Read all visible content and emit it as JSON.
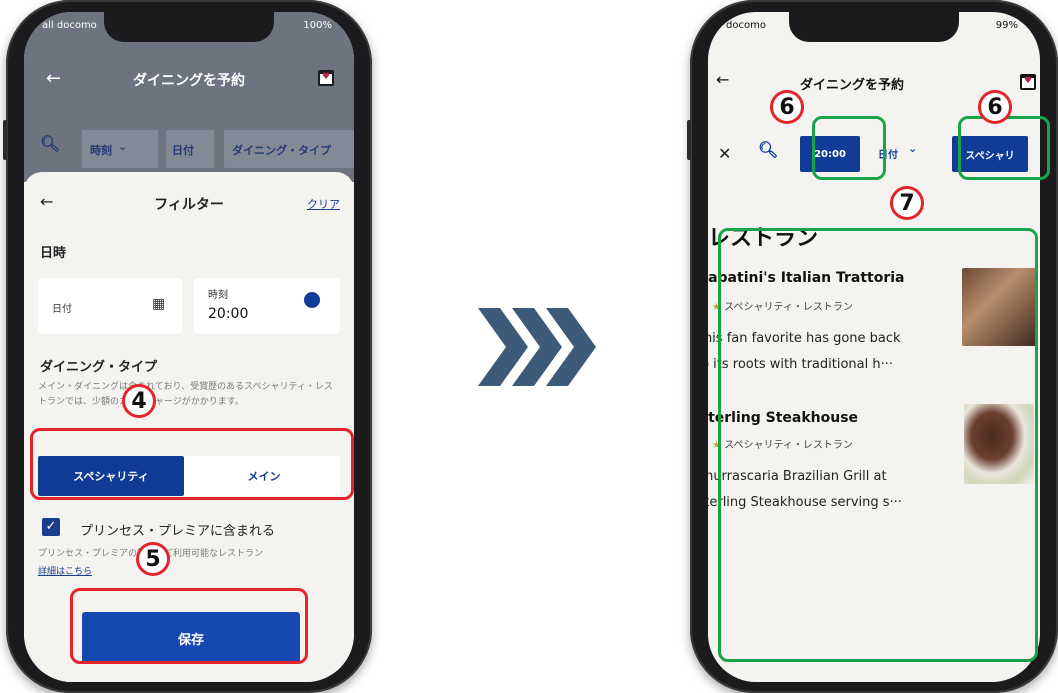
{
  "left_phone": {
    "status": {
      "carrier": "all docomo",
      "battery": "100%"
    },
    "appbar": {
      "title": "ダイニングを予約"
    },
    "chips": [
      {
        "label": "時刻"
      },
      {
        "label": "日付"
      },
      {
        "label": "ダイニング・タイプ"
      }
    ],
    "filter": {
      "title": "フィルター",
      "clear": "クリア",
      "datetime_heading": "日時",
      "date_label": "日付",
      "time_label": "時刻",
      "time_value": "20:00",
      "dining_type_heading": "ダイニング・タイプ",
      "dining_type_desc": "メイン・ダイニングは含まれており、受賞歴のあるスペシャリティ・レストランでは、少額のカバーチャージがかかります。",
      "options": [
        "スペシャリティ",
        "メイン"
      ],
      "selected_option": "スペシャリティ",
      "checkbox_label": "プリンセス・プレミアに含まれる",
      "checkbox_checked": true,
      "checkbox_note": "プリンセス・プレミアの特典でご利用可能なレストラン",
      "details_link": "詳細はこちら",
      "save": "保存"
    },
    "markers": {
      "step4": "4",
      "step5": "5"
    }
  },
  "right_phone": {
    "status": {
      "carrier": "docomo",
      "battery": "99%"
    },
    "appbar": {
      "title": "ダイニングを予約"
    },
    "chips": {
      "close": "✕",
      "time": "20:00",
      "date": "日付",
      "type": "スペシャリ"
    },
    "heading": "レストラン",
    "restaurants": [
      {
        "name": "Sabatini's Italian Trattoria",
        "type": "スペシャリティ・レストラン",
        "desc_line1": "This fan favorite has gone back",
        "desc_line2": "to its roots with traditional h···"
      },
      {
        "name": "Sterling Steakhouse",
        "type": "スペシャリティ・レストラン",
        "desc_line1": "Churrascaria Brazilian Grill at",
        "desc_line2": "Sterling Steakhouse serving s···"
      }
    ],
    "markers": {
      "step6a": "6",
      "step6b": "6",
      "step7": "7"
    }
  },
  "colors": {
    "brand_blue": "#103c98",
    "highlight_red": "#e5232b",
    "highlight_green": "#19a44a",
    "arrow": "#3d5a78"
  }
}
